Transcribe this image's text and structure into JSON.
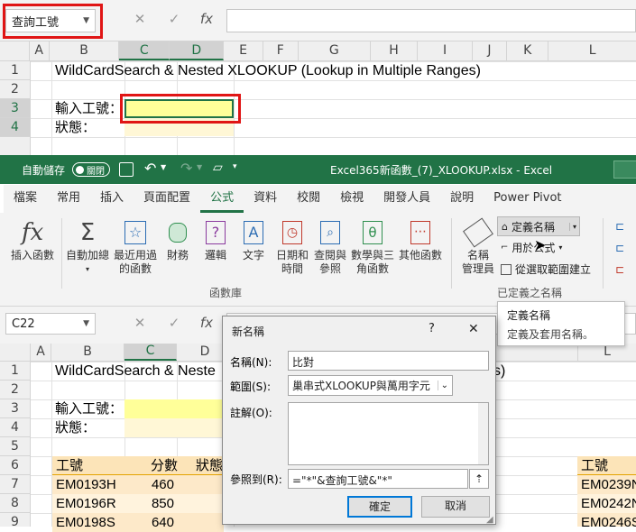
{
  "top": {
    "namebox": "查詢工號",
    "fx": "fx",
    "columns": [
      "A",
      "B",
      "C",
      "D",
      "E",
      "F",
      "G",
      "H",
      "I",
      "J",
      "K",
      "L"
    ],
    "rows": [
      "1",
      "2",
      "3",
      "4"
    ],
    "title_text": "WildCardSearch & Nested XLOOKUP  (Lookup in Multiple Ranges)",
    "label_input": "輸入工號：",
    "label_status": "狀態："
  },
  "titlebar": {
    "autosave": "自動儲存",
    "toggle": "關閉",
    "filename": "Excel365新函數_(7)_XLOOKUP.xlsx  -  Excel"
  },
  "tabs": [
    "檔案",
    "常用",
    "插入",
    "頁面配置",
    "公式",
    "資料",
    "校閱",
    "檢視",
    "開發人員",
    "說明",
    "Power Pivot",
    "⁄"
  ],
  "active_tab": "公式",
  "ribbon": {
    "insert_fn": "插入函數",
    "autosum": [
      "自動加總"
    ],
    "recent": [
      "最近用過",
      "的函數"
    ],
    "financial": "財務",
    "logical": "邏輯",
    "text": "文字",
    "datetime": [
      "日期和",
      "時間"
    ],
    "lookup": [
      "查閱與",
      "參照"
    ],
    "math": [
      "數學與三",
      "角函數"
    ],
    "more": "其他函數",
    "group_label": "函數庫",
    "name_mgr": [
      "名稱",
      "管理員"
    ],
    "define_name": "定義名稱",
    "use_formula": "用於公式",
    "create_sel": "從選取範圍建立",
    "defined_names_group": "已定義之名稱"
  },
  "bottom": {
    "namebox": "C22",
    "fx": "fx",
    "columns": [
      "A",
      "B",
      "C",
      "D"
    ],
    "rows": [
      "1",
      "2",
      "3",
      "4",
      "5",
      "6",
      "7",
      "8",
      "9"
    ],
    "title_text": "WildCardSearch & Neste",
    "title_tail": "s)",
    "label_input": "輸入工號：",
    "label_status": "狀態：",
    "hdr_id": "工號",
    "hdr_score": "分數",
    "hdr_status": "狀態",
    "data": [
      {
        "id": "EM0193H",
        "score": "460"
      },
      {
        "id": "EM0196R",
        "score": "850"
      },
      {
        "id": "EM0198S",
        "score": "640"
      }
    ],
    "right_hdr": "工號",
    "right_col": "L",
    "right_data": [
      "EM0239N",
      "EM0242N",
      "EM0246S"
    ]
  },
  "tooltip": {
    "title": "定義名稱",
    "desc": "定義及套用名稱。"
  },
  "dialog": {
    "title": "新名稱",
    "help": "?",
    "close": "✕",
    "name_label": "名稱(N):",
    "name_value": "比對",
    "scope_label": "範圍(S):",
    "scope_value": "巢串式XLOOKUP與萬用字元",
    "comment_label": "註解(O):",
    "refers_label": "參照到(R):",
    "refers_value": "=\"*\"&查詢工號&\"*\"",
    "ok": "確定",
    "cancel": "取消"
  },
  "colors": {
    "excel_green": "#217346",
    "highlight_yellow": "#ffff99",
    "table_fill": "#fce4b8",
    "red_box": "#e01515"
  }
}
